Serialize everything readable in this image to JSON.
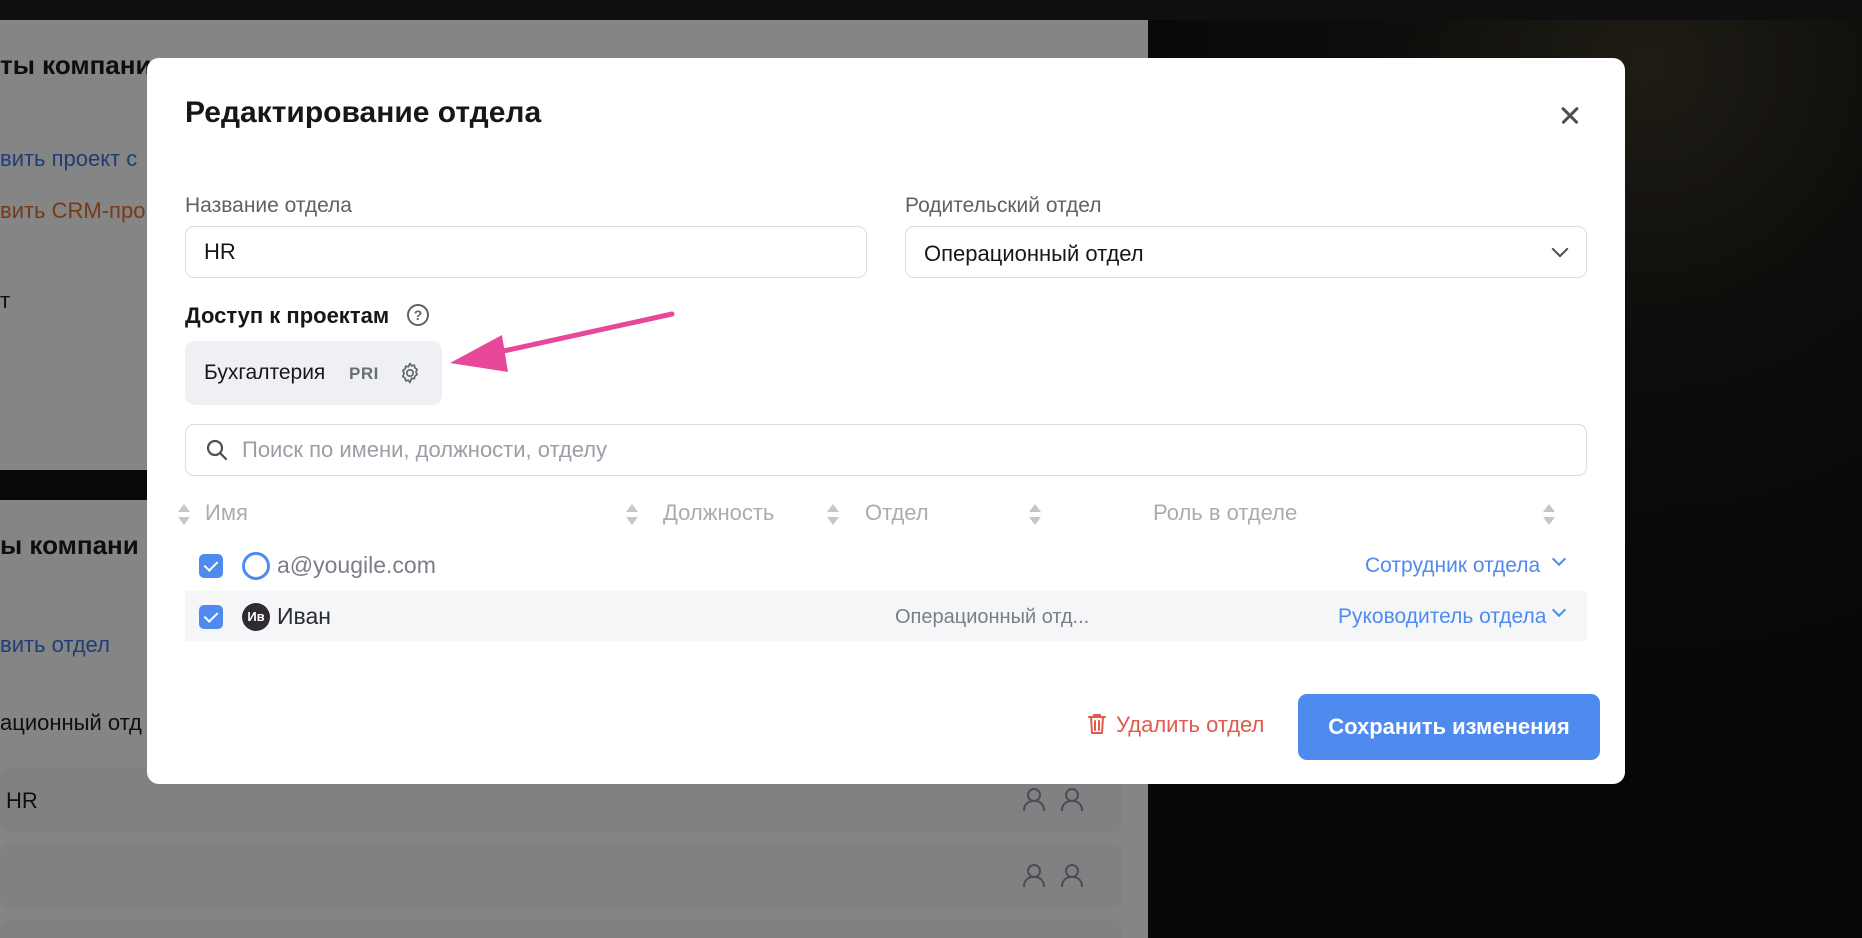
{
  "background": {
    "heading_top": "ты компани",
    "link_project": "вить проект с",
    "link_crm": "вить CRM-про",
    "text_partial": "т",
    "heading_bottom": "ы компани",
    "link_department": "вить отдел",
    "dept_item_1": "ационный отд",
    "dept_item_2": "HR"
  },
  "modal": {
    "title": "Редактирование отдела",
    "name_label": "Название отдела",
    "name_value": "HR",
    "parent_label": "Родительский отдел",
    "parent_value": "Операционный отдел",
    "access_title": "Доступ к проектам",
    "help_glyph": "?",
    "project": {
      "name": "Бухгалтерия",
      "tag": "PRI"
    },
    "search_placeholder": "Поиск по имени, должности, отделу",
    "table": {
      "headers": {
        "name": "Имя",
        "position": "Должность",
        "department": "Отдел",
        "role": "Роль в отделе"
      },
      "rows": [
        {
          "name": "a@yougile.com",
          "avatar": "outline-avatar-icon",
          "department": "",
          "role": "Сотрудник отдела",
          "checked": true
        },
        {
          "name": "Иван",
          "avatar_initials": "Ив",
          "department": "Операционный отд...",
          "role": "Руководитель отдела",
          "checked": true
        }
      ]
    },
    "delete_label": "Удалить отдел",
    "save_label": "Сохранить изменения"
  },
  "colors": {
    "accent": "#4f8bef",
    "danger": "#e25a4a",
    "annotation_arrow": "#e8489a"
  }
}
